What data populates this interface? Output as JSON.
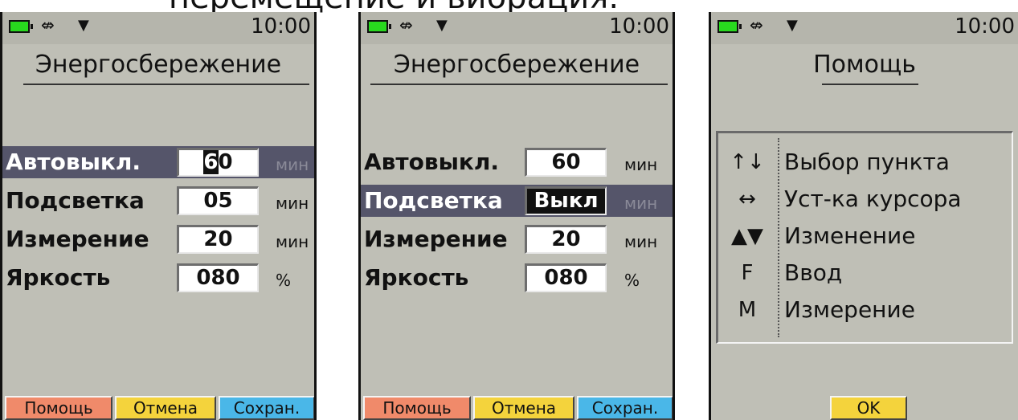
{
  "caption": "перемещение и вибрация.",
  "status": {
    "time": "10:00",
    "usb_glyph": "⇎",
    "signal_glyph": "▼"
  },
  "screens": [
    {
      "title": "Энергосбережение",
      "rows": [
        {
          "label": "Автовыкл.",
          "value_cursor": "6",
          "value_rest": "0",
          "unit": "мин",
          "selected": true
        },
        {
          "label": "Подсветка",
          "value": "05",
          "unit": "мин"
        },
        {
          "label": "Измерение",
          "value": "20",
          "unit": "мин"
        },
        {
          "label": "Яркость",
          "value": "080",
          "unit": "%"
        }
      ],
      "softkeys": {
        "help": "Помощь",
        "cancel": "Отмена",
        "save": "Сохран."
      }
    },
    {
      "title": "Энергосбережение",
      "rows": [
        {
          "label": "Автовыкл.",
          "value": "60",
          "unit": "мин"
        },
        {
          "label": "Подсветка",
          "value": "Выкл",
          "unit": "мин",
          "selected": true
        },
        {
          "label": "Измерение",
          "value": "20",
          "unit": "мин"
        },
        {
          "label": "Яркость",
          "value": "080",
          "unit": "%"
        }
      ],
      "softkeys": {
        "help": "Помощь",
        "cancel": "Отмена",
        "save": "Сохран."
      }
    },
    {
      "title": "Помощь",
      "help_items": [
        {
          "key": "↑↓",
          "text": "Выбор пункта"
        },
        {
          "key": "↔",
          "text": "Уст-ка курсора"
        },
        {
          "key": "▲▼",
          "text": "Изменение"
        },
        {
          "key": "F",
          "text": "Ввод"
        },
        {
          "key": "M",
          "text": "Измерение"
        }
      ],
      "ok_label": "OK"
    }
  ],
  "colors": {
    "screen_bg": "#bfbfb6",
    "selected_row": "#55556a",
    "battery": "#28d81e",
    "key_help": "#f08a6a",
    "key_cancel": "#f4d33c",
    "key_save": "#4ab7e8"
  }
}
